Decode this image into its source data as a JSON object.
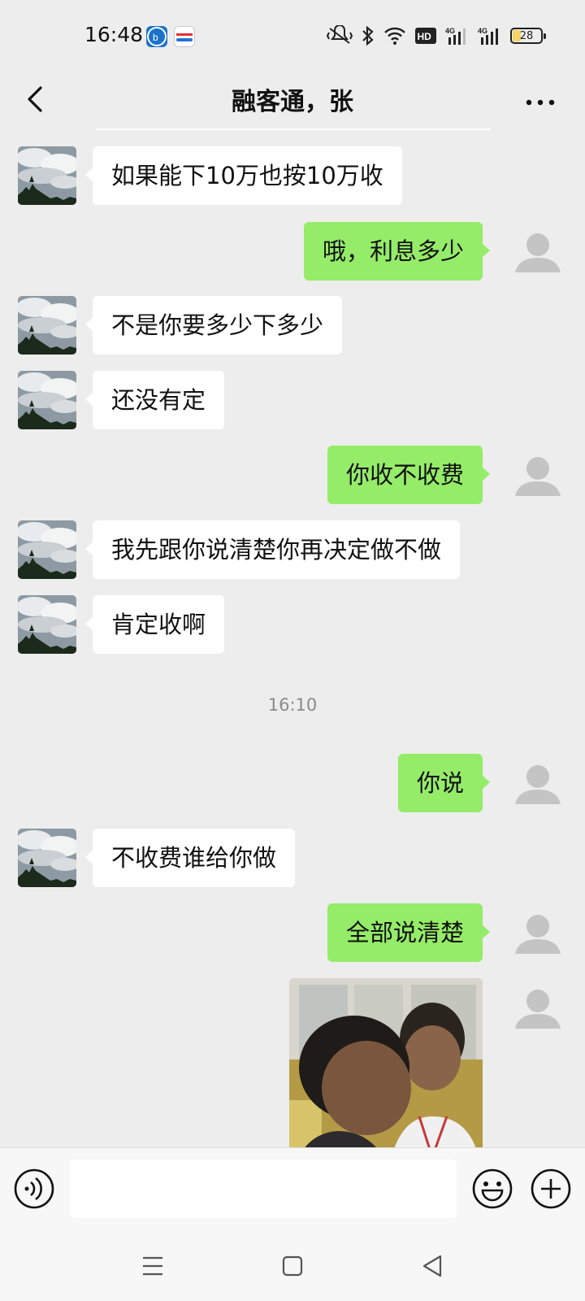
{
  "status_bar": {
    "time": "16:48",
    "network_labels": [
      "HD",
      "4G",
      "4G"
    ],
    "battery": "28",
    "battery_level": 0.28,
    "icons": [
      "app-icon-1",
      "app-icon-2",
      "mute-icon",
      "bluetooth-icon",
      "wifi-icon",
      "hd-icon",
      "signal-4g-icon",
      "signal-4g-icon",
      "battery-icon"
    ]
  },
  "header": {
    "title": "融客通，张",
    "back_icon": "chevron-left-icon",
    "more_icon": "more-dots-icon"
  },
  "chat": {
    "messages": [
      {
        "side": "left",
        "text": "如果能下10万也按10万收"
      },
      {
        "side": "right",
        "text": "哦，利息多少"
      },
      {
        "side": "left",
        "text": "不是你要多少下多少"
      },
      {
        "side": "left",
        "text": "还没有定"
      },
      {
        "side": "right",
        "text": "你收不收费"
      },
      {
        "side": "left",
        "text": "我先跟你说清楚你再决定做不做"
      },
      {
        "side": "left",
        "text": "肯定收啊"
      },
      {
        "side": "right",
        "text": "你说"
      },
      {
        "side": "left",
        "text": "不收费谁给你做"
      },
      {
        "side": "right",
        "text": "全部说清楚"
      }
    ],
    "timestamp": "16:10",
    "photo_message": {
      "side": "right",
      "icon": "photo-image"
    }
  },
  "input_bar": {
    "value": "",
    "voice_icon": "voice-icon",
    "emoji_icon": "emoji-icon",
    "plus_icon": "plus-icon"
  },
  "system_nav": {
    "icons": [
      "menu-icon",
      "home-icon",
      "back-triangle-icon"
    ]
  },
  "colors": {
    "background": "#ededed",
    "bubble_self": "#95ec69",
    "bubble_other": "#ffffff",
    "text": "#111111",
    "timestamp": "#8a8a8a"
  }
}
